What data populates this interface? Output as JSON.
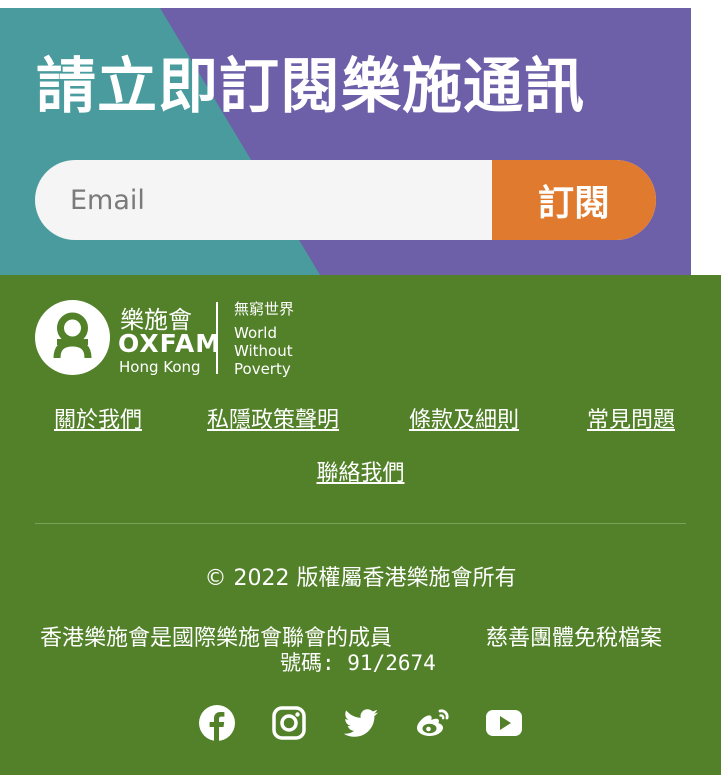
{
  "subscribe": {
    "title": "請立即訂閱樂施通訊",
    "email_placeholder": "Email",
    "button_label": "訂閱",
    "colors": {
      "teal": "#4a9b9e",
      "purple": "#6d60a8",
      "orange": "#e07a2e"
    }
  },
  "footer": {
    "background": "#528129",
    "logo": {
      "name_cn": "樂施會",
      "name_en": "OXFAM",
      "region": "Hong Kong",
      "tagline_cn": "無窮世界",
      "tagline_en": [
        "World",
        "Without",
        "Poverty"
      ]
    },
    "links": [
      "關於我們",
      "私隱政策聲明",
      "條款及細則",
      "常見問題",
      "聯絡我們"
    ],
    "copyright": "© 2022 版權屬香港樂施會所有",
    "member_note": "香港樂施會是國際樂施會聯會的成員",
    "charity_label": "慈善團體免稅檔案",
    "charity_number": "號碼: 91/2674",
    "social": [
      "facebook-icon",
      "instagram-icon",
      "twitter-icon",
      "weibo-icon",
      "youtube-icon"
    ]
  }
}
